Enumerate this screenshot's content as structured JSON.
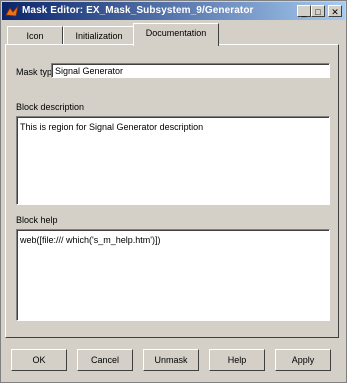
{
  "window": {
    "title": "Mask Editor: EX_Mask_Subsystem_9/Generator",
    "minimize_glyph": "_",
    "maximize_glyph": "□",
    "close_glyph": "✕"
  },
  "tabs": [
    {
      "label": "Icon",
      "active": false
    },
    {
      "label": "Initialization",
      "active": false
    },
    {
      "label": "Documentation",
      "active": true
    }
  ],
  "documentation": {
    "mask_type_label": "Mask type",
    "mask_type_value": "Signal Generator",
    "block_description_label": "Block description",
    "block_description_value": "This is region for Signal Generator description",
    "block_help_label": "Block help",
    "block_help_value": "web([file:/// which('s_m_help.htm')])"
  },
  "buttons": {
    "ok": "OK",
    "cancel": "Cancel",
    "unmask": "Unmask",
    "help": "Help",
    "apply": "Apply"
  },
  "colors": {
    "title_bar_start": "#0a246a",
    "title_bar_end": "#a6caf0",
    "face": "#d4d0c8"
  }
}
